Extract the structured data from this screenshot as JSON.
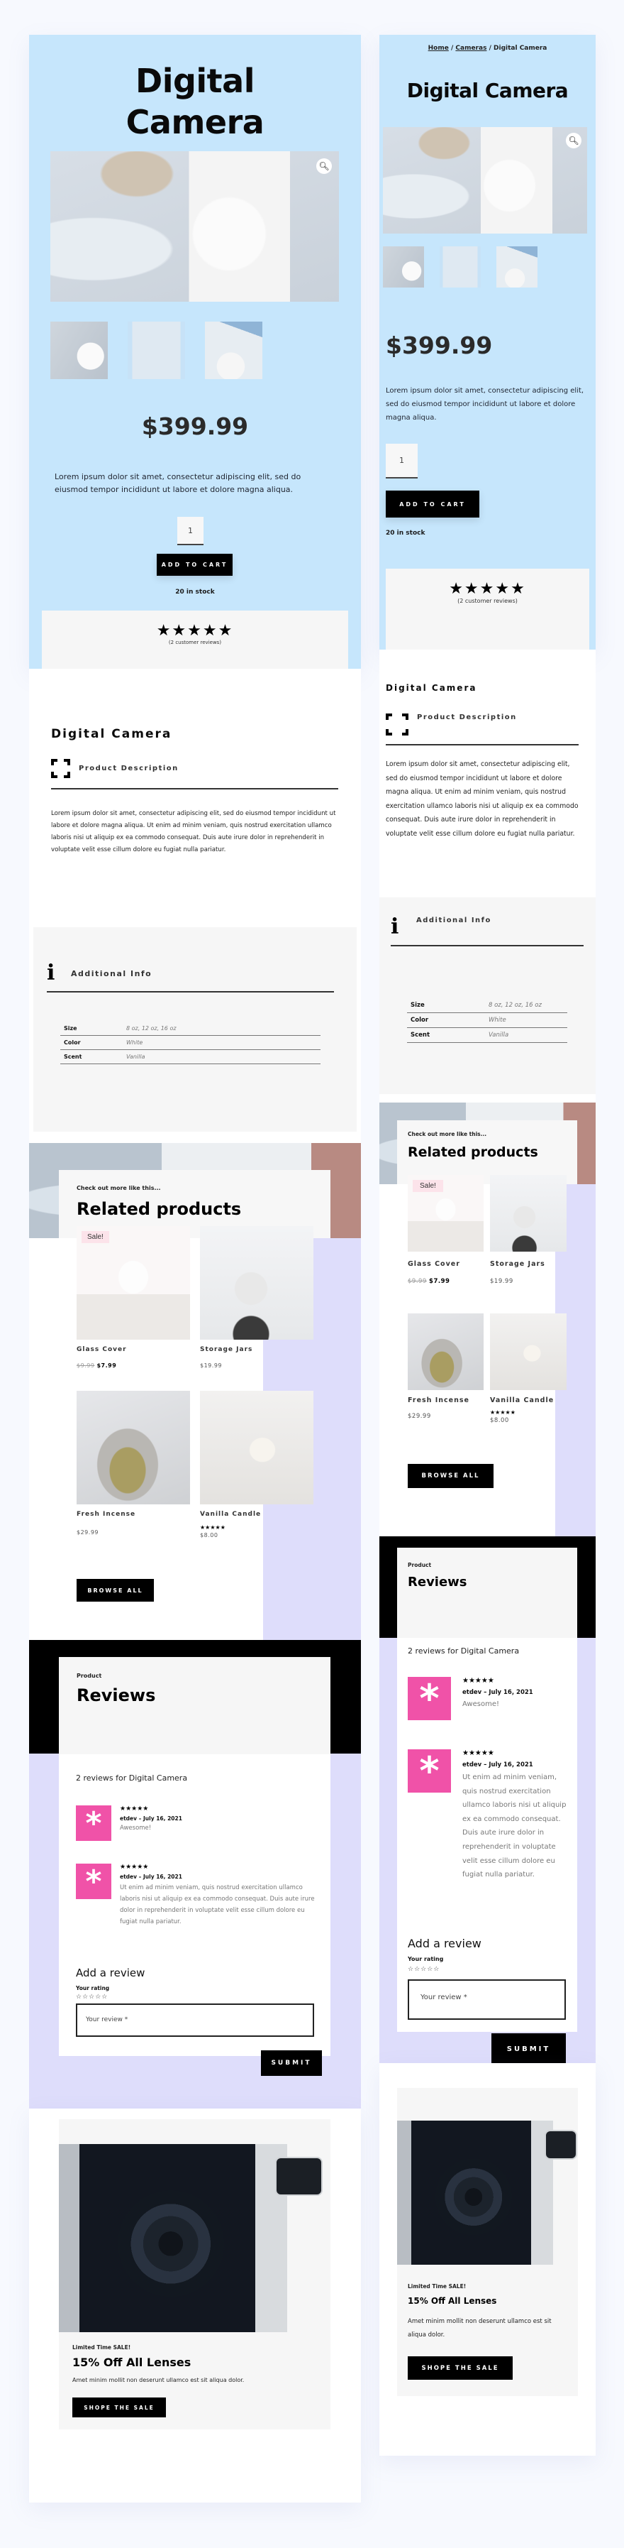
{
  "product": {
    "title": "Digital Camera",
    "title_line1": "Digital",
    "title_line2": "Camera",
    "price": "$399.99",
    "short_description": "Lorem ipsum dolor sit amet, consectetur adipiscing elit, sed do eiusmod tempor incididunt ut labore et dolore magna aliqua.",
    "quantity": "1",
    "add_to_cart": "ADD TO CART",
    "stock": "20 in stock",
    "rating_stars": "★★★★★",
    "rating_value": 5,
    "rating_max": 5,
    "review_count_label": "(2 customer reviews)",
    "zoom_icon": "search-icon"
  },
  "breadcrumb": {
    "items": [
      {
        "label": "Home",
        "link": true
      },
      {
        "label": "Cameras",
        "link": true
      },
      {
        "label": "Digital Camera",
        "link": false
      }
    ],
    "separator": "/"
  },
  "description": {
    "heading": "Digital Camera",
    "tab_title": "Product Description",
    "text": "Lorem ipsum dolor sit amet, consectetur adipiscing elit, sed do eiusmod tempor incididunt ut labore et dolore magna aliqua. Ut enim ad minim veniam, quis nostrud exercitation ullamco laboris nisi ut aliquip ex ea commodo consequat. Duis aute irure dolor in reprehenderit in voluptate velit esse cillum dolore eu fugiat nulla pariatur."
  },
  "additional_info": {
    "title": "Additional Info",
    "rows": [
      {
        "label": "Size",
        "value": "8 oz, 12 oz, 16 oz"
      },
      {
        "label": "Color",
        "value": "White"
      },
      {
        "label": "Scent",
        "value": "Vanilla"
      }
    ]
  },
  "related": {
    "subtitle": "Check out more like this...",
    "title": "Related products",
    "browse_all": "BROWSE ALL",
    "products": [
      {
        "name": "Glass Cover",
        "old_price": "$9.99",
        "price": "$7.99",
        "sale_badge": "Sale!",
        "stars": ""
      },
      {
        "name": "Storage Jars",
        "old_price": "",
        "price": "$19.99",
        "sale_badge": "",
        "stars": ""
      },
      {
        "name": "Fresh Incense",
        "old_price": "",
        "price": "$29.99",
        "sale_badge": "",
        "stars": ""
      },
      {
        "name": "Vanilla Candle",
        "old_price": "",
        "price": "$8.00",
        "sale_badge": "",
        "stars": "★★★★★"
      }
    ]
  },
  "reviews": {
    "pretitle": "Product",
    "title": "Reviews",
    "count_heading": "2 reviews for Digital Camera",
    "items": [
      {
        "stars": "★★★★★",
        "author": "etdev",
        "date": "July 16, 2021",
        "meta": "etdev – July 16, 2021",
        "text": "Awesome!"
      },
      {
        "stars": "★★★★★",
        "author": "etdev",
        "date": "July 16, 2021",
        "meta": "etdev – July 16, 2021",
        "text": "Ut enim ad minim veniam, quis nostrud exercitation ullamco laboris nisi ut aliquip ex ea commodo consequat. Duis aute irure dolor in reprehenderit in voluptate velit esse cillum dolore eu fugiat nulla pariatur."
      }
    ],
    "avatar_glyph": "*",
    "add_title": "Add a review",
    "rating_label": "Your rating",
    "empty_stars": "☆☆☆☆☆",
    "review_placeholder": "Your review *",
    "submit": "SUBMIT"
  },
  "promo": {
    "pretitle": "Limited Time SALE!",
    "title": "15% Off All Lenses",
    "text": "Amet minim mollit non deserunt ullamco est sit aliqua dolor.",
    "button": "SHOPE THE SALE"
  },
  "colors": {
    "hero_bg": "#c6e6fc",
    "lavender": "#deddfb",
    "avatar_pink": "#f052a8",
    "button_black": "#000000",
    "card_gray": "#f6f6f6"
  }
}
